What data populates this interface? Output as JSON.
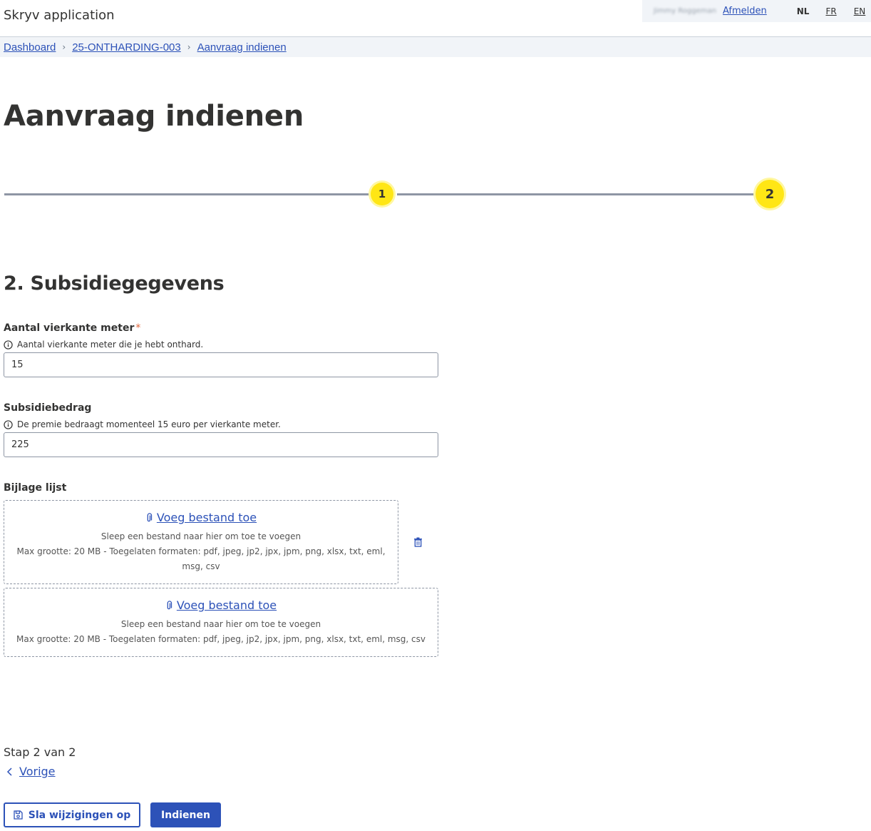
{
  "app": {
    "title": "Skryv application"
  },
  "user": {
    "name": "Jimmy Roggeman",
    "logout_label": "Afmelden"
  },
  "languages": [
    {
      "code": "NL",
      "active": true
    },
    {
      "code": "FR",
      "active": false
    },
    {
      "code": "EN",
      "active": false
    }
  ],
  "breadcrumb": [
    {
      "label": "Dashboard"
    },
    {
      "label": "25-ONTHARDING-003"
    },
    {
      "label": "Aanvraag indienen"
    }
  ],
  "page": {
    "title": "Aanvraag indienen"
  },
  "progress": {
    "steps": [
      "1",
      "2"
    ],
    "current": 2
  },
  "section": {
    "title": "2. Subsidiegegevens"
  },
  "fields": {
    "area": {
      "label": "Aantal vierkante meter",
      "required_mark": "*",
      "hint": "Aantal vierkante meter die je hebt onthard.",
      "value": "15"
    },
    "amount": {
      "label": "Subsidiebedrag",
      "hint": "De premie bedraagt momenteel 15 euro per vierkante meter.",
      "value": "225"
    },
    "attachments": {
      "label": "Bijlage lijst",
      "dropzones": [
        {
          "link": "Voeg bestand toe",
          "drag_text": "Sleep een bestand naar hier om toe te voegen",
          "limits": "Max grootte: 20 MB - Toegelaten formaten: pdf, jpeg, jp2, jpx, jpm, png, xlsx, txt, eml, msg, csv"
        },
        {
          "link": "Voeg bestand toe",
          "drag_text": "Sleep een bestand naar hier om toe te voegen",
          "limits": "Max grootte: 20 MB - Toegelaten formaten: pdf, jpeg, jp2, jpx, jpm, png, xlsx, txt, eml, msg, csv"
        }
      ]
    }
  },
  "footer": {
    "step_count": "Stap 2 van 2",
    "back_label": "Vorige",
    "save_label": "Sla wijzigingen op",
    "submit_label": "Indienen"
  },
  "colors": {
    "accent": "#2d52b8",
    "step": "#ffe615",
    "required": "#e1653b",
    "border": "#8e96a4"
  },
  "icons": [
    "info-icon",
    "paperclip-icon",
    "trash-icon",
    "chevron-left-icon",
    "save-icon",
    "chevron-right-icon"
  ]
}
